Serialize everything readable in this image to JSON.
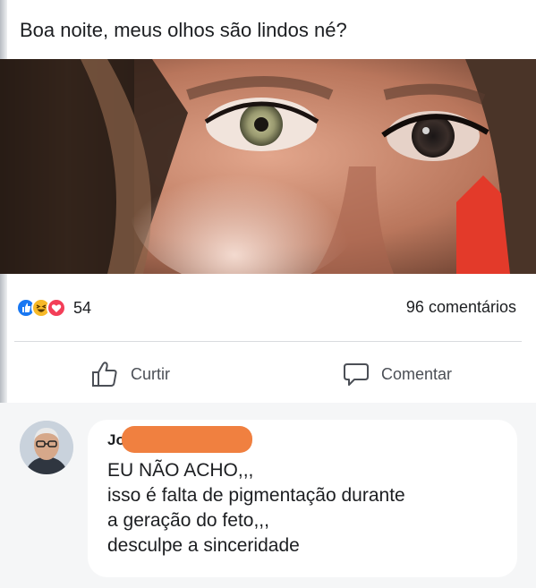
{
  "post": {
    "text": "Boa noite, meus olhos são lindos né?"
  },
  "reactions": {
    "icons": [
      "like-icon",
      "haha-icon",
      "love-icon"
    ],
    "count": "54",
    "comments": "96 comentários"
  },
  "actions": {
    "like_label": "Curtir",
    "comment_label": "Comentar"
  },
  "comment": {
    "author": "Jo                    es",
    "text": "EU  NÃO ACHO,,,\nisso é falta de pigmentação durante\na geração do feto,,,\ndesculpe a sinceridade"
  },
  "colors": {
    "like": "#1877f2",
    "haha": "#f7b928",
    "love": "#f33e58",
    "redaction": "#f08040"
  }
}
